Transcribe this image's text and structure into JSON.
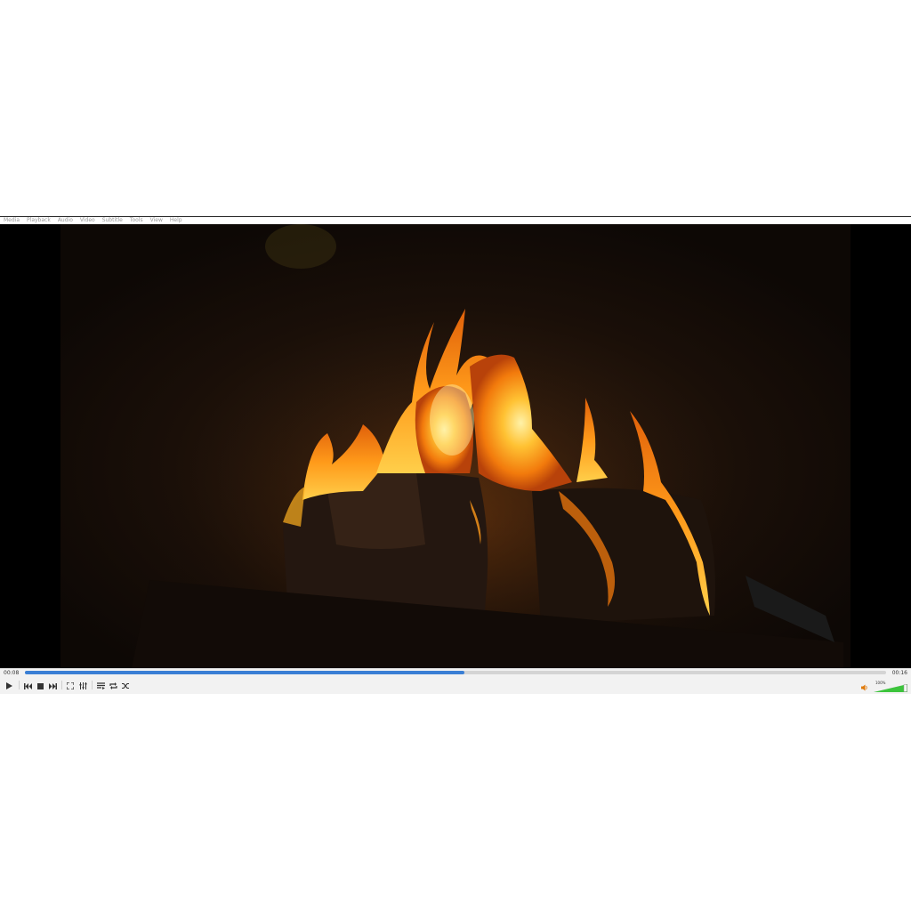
{
  "menubar": {
    "items": [
      "Media",
      "Playback",
      "Audio",
      "Video",
      "Subtitle",
      "Tools",
      "View",
      "Help"
    ]
  },
  "player": {
    "elapsed": "00:08",
    "total": "00:16",
    "progress": 0.51,
    "volume_label": "100%",
    "volume": 1.0,
    "accent_color": "#3a7fd5",
    "volume_color": "#3cc43c"
  },
  "controls": {
    "icons": [
      "play-icon",
      "previous-icon",
      "stop-icon",
      "next-icon",
      "fullscreen-icon",
      "extended-settings-icon",
      "playlist-icon",
      "loop-icon",
      "shuffle-icon",
      "speaker-icon"
    ]
  }
}
